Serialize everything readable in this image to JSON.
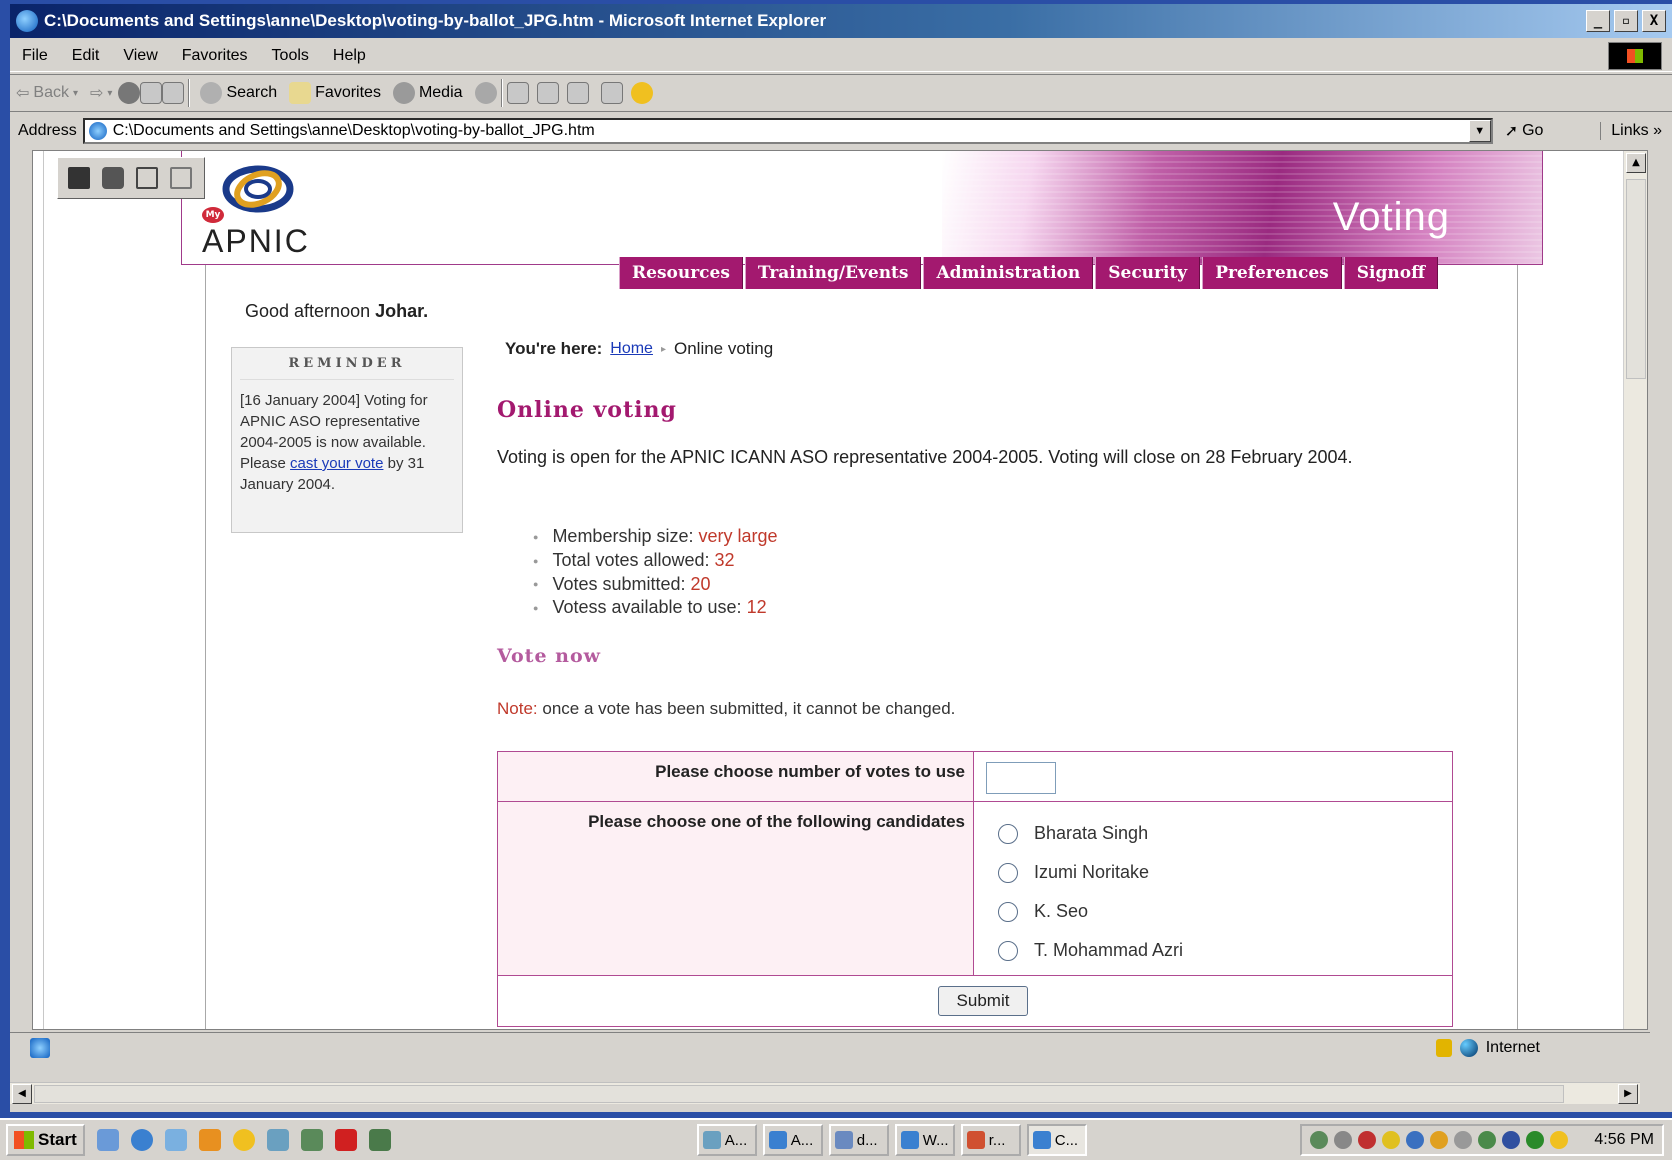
{
  "window": {
    "title": "C:\\Documents and Settings\\anne\\Desktop\\voting-by-ballot_JPG.htm - Microsoft Internet Explorer",
    "minimize": "_",
    "maximize": "▫",
    "close": "X"
  },
  "menu": [
    "File",
    "Edit",
    "View",
    "Favorites",
    "Tools",
    "Help"
  ],
  "toolbar": {
    "back": "Back",
    "search": "Search",
    "favorites": "Favorites",
    "media": "Media"
  },
  "address": {
    "label": "Address",
    "url": "C:\\Documents and Settings\\anne\\Desktop\\voting-by-ballot_JPG.htm",
    "go": "Go",
    "links": "Links"
  },
  "header": {
    "logo_text": "APNIC",
    "logo_badge": "My",
    "section_title": "Voting"
  },
  "nav": [
    "Resources",
    "Training/Events",
    "Administration",
    "Security",
    "Preferences",
    "Signoff"
  ],
  "greeting": {
    "text": "Good afternoon ",
    "name": "Johar."
  },
  "reminder": {
    "title": "REMINDER",
    "before": "[16 January 2004] Voting for APNIC ASO representative 2004-2005 is now available. Please ",
    "link": "cast your vote",
    "after": " by 31 January 2004."
  },
  "breadcrumb": {
    "label": "You're here:",
    "home": "Home",
    "current": "Online voting"
  },
  "main": {
    "title": "Online voting",
    "intro": "Voting is open for the APNIC ICANN ASO representative 2004-2005. Voting will close on 28 February 2004.",
    "stats": [
      {
        "label": "Membership size: ",
        "value": "very large"
      },
      {
        "label": "Total votes allowed: ",
        "value": "32"
      },
      {
        "label": "Votes submitted: ",
        "value": "20"
      },
      {
        "label": "Votess available to use: ",
        "value": "12"
      }
    ],
    "vote_heading": "Vote now",
    "note_label": "Note:",
    "note_text": " once a vote has been submitted, it cannot be changed."
  },
  "form": {
    "votes_label": "Please choose number of votes to use",
    "votes_value": "",
    "candidates_label": "Please choose one of the following candidates",
    "candidates": [
      "Bharata Singh",
      "Izumi Noritake",
      "K. Seo",
      "T. Mohammad Azri"
    ],
    "submit": "Submit"
  },
  "status": {
    "zone": "Internet"
  },
  "taskbar": {
    "start": "Start",
    "tasks": [
      "A...",
      "A...",
      "d...",
      "W...",
      "r...",
      "C..."
    ],
    "clock": "4:56 PM"
  },
  "colors": {
    "brand": "#a3196f",
    "accent_value": "#c0392b",
    "link": "#1a3ab8"
  }
}
